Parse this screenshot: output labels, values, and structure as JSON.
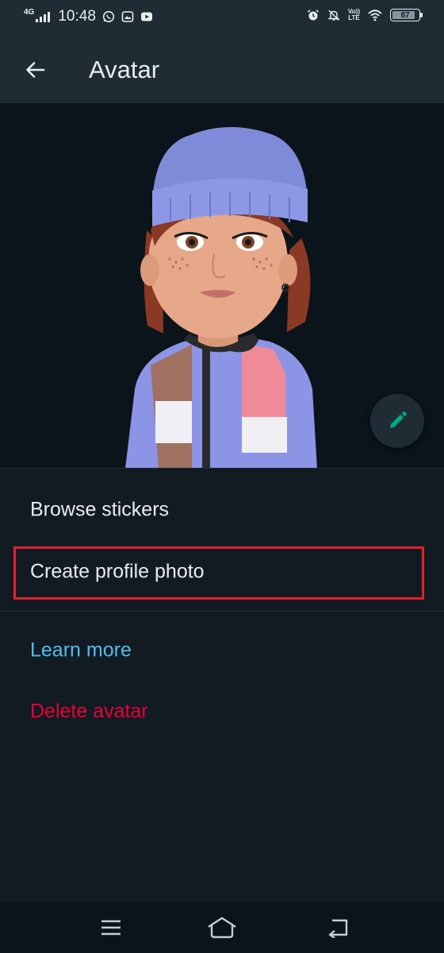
{
  "status_bar": {
    "network_type": "4G",
    "time": "10:48",
    "volte_text_top": "Vo))",
    "volte_text_bottom": "LTE",
    "battery_level": "87",
    "battery_fraction": 0.87,
    "left_icons": [
      "whatsapp-icon",
      "gallery-icon",
      "youtube-icon"
    ],
    "right_icons": [
      "alarm-icon",
      "notifications-off-icon",
      "volte-icon",
      "wifi-icon",
      "battery-icon"
    ]
  },
  "app_bar": {
    "title": "Avatar",
    "back_icon": "arrow-left-icon"
  },
  "avatar": {
    "edit_icon": "pencil-icon",
    "colors": {
      "beanie": "#7f8bd9",
      "hair": "#8a3a24",
      "skin": "#e6a889",
      "jacket_pink": "#f08a97",
      "jacket_blue": "#8c94e6",
      "jacket_brown": "#a07160"
    }
  },
  "menu": {
    "browse_stickers": "Browse stickers",
    "create_profile_photo": "Create profile photo",
    "learn_more": "Learn more",
    "delete_avatar": "Delete avatar"
  },
  "colors": {
    "background": "#121b22",
    "bar": "#1f2c34",
    "link": "#53bdeb",
    "danger": "#ea0038",
    "accent": "#00a884",
    "highlight": "#e3202f"
  },
  "nav_bar": {
    "icons": [
      "menu-icon",
      "home-icon",
      "back-icon"
    ]
  }
}
